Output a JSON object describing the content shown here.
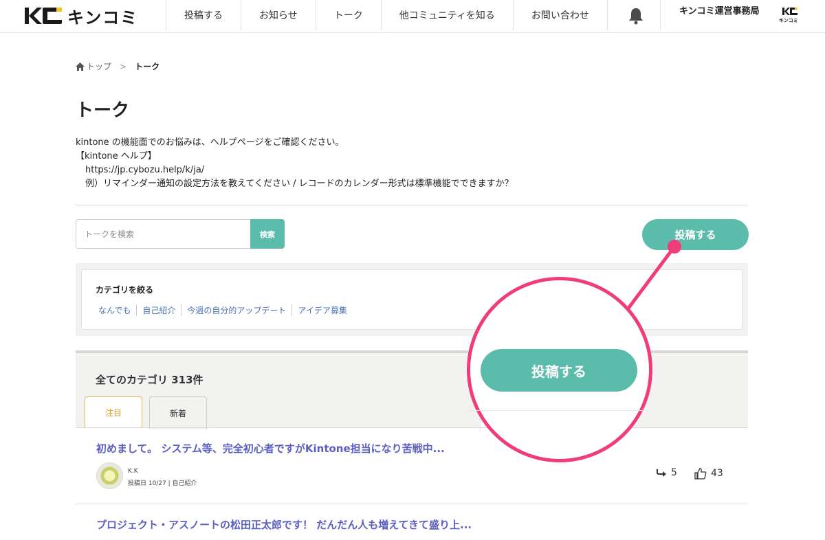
{
  "header": {
    "logo_text": "キンコミ",
    "nav": [
      "投稿する",
      "お知らせ",
      "トーク",
      "他コミュニティを知る",
      "お問い合わせ"
    ],
    "user_name": "キンコミ運営事務局",
    "user_avatar_text": "キンコミ"
  },
  "breadcrumb": {
    "home": "トップ",
    "separator": ">",
    "current": "トーク"
  },
  "page": {
    "title": "トーク",
    "desc_line1": "kintone の機能面でのお悩みは、ヘルプページをご確認ください。",
    "desc_line2": "【kintone ヘルプ】",
    "desc_line3": "https://jp.cybozu.help/k/ja/",
    "desc_line4": "例）リマインダー通知の設定方法を教えてください / レコードのカレンダー形式は標準機能でできますか？"
  },
  "search": {
    "placeholder": "トークを検索",
    "button": "検索"
  },
  "post_button": "投稿する",
  "categories": {
    "title": "カテゴリを絞る",
    "items": [
      "なんでも",
      "自己紹介",
      "今週の自分的アップデート",
      "アイデア募集"
    ]
  },
  "list": {
    "count_title": "全てのカテゴリ 313件",
    "tabs": [
      "注目",
      "新着"
    ],
    "posts": [
      {
        "title": "初めまして。 システム等、完全初心者ですがKintone担当になり苦戦中...",
        "author": "K.K",
        "meta": "投稿日 10/27 | 自己紹介",
        "replies": "5",
        "likes": "43"
      },
      {
        "title": "プロジェクト・アスノートの松田正太郎です！ だんだん人も増えてきて盛り上..."
      }
    ]
  },
  "callout": {
    "label": "投稿する",
    "color": "#f03c78"
  },
  "colors": {
    "accent": "#5cbcab",
    "link": "#4a72b8",
    "post_title": "#5a5ec0"
  }
}
